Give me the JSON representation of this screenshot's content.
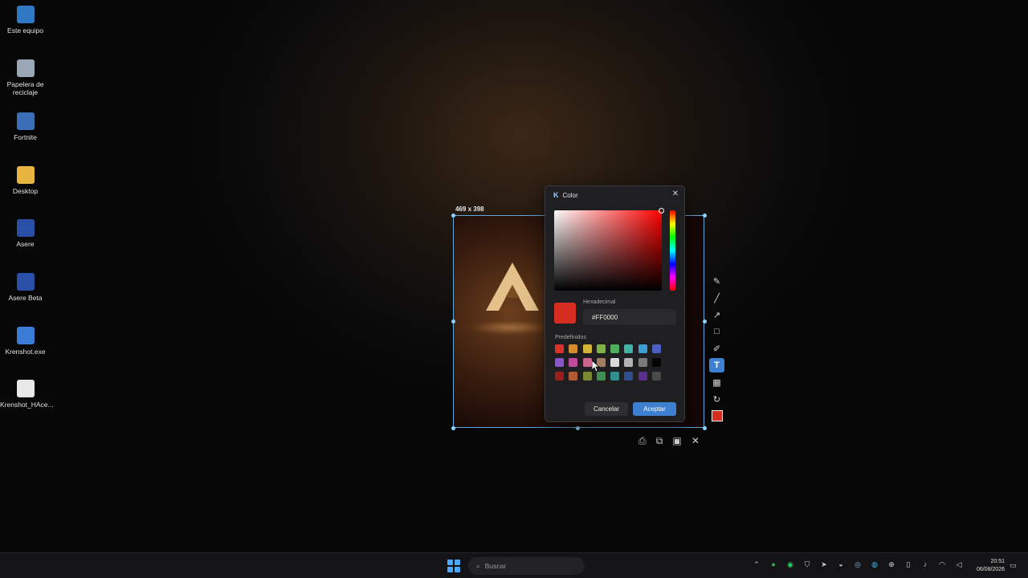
{
  "desktop": {
    "icons": [
      {
        "label": "Este equipo",
        "icon": "computer-icon",
        "color": "#2f78c6"
      },
      {
        "label": "Papelera de reciclaje",
        "icon": "recycle-bin-icon",
        "color": "#9aa7b5"
      },
      {
        "label": "Fortnite",
        "icon": "fortnite-icon",
        "color": "#3a6fb8"
      },
      {
        "label": "Desktop",
        "icon": "folder-icon",
        "color": "#e6b43f"
      },
      {
        "label": "Asere",
        "icon": "asere-icon",
        "color": "#2a4fa8"
      },
      {
        "label": "Asere Beta",
        "icon": "asere-beta-icon",
        "color": "#2a4fa8"
      },
      {
        "label": "Krenshot.exe",
        "icon": "krenshot-icon",
        "color": "#3a7bd5"
      },
      {
        "label": "Krenshot_HAce...",
        "icon": "file-icon",
        "color": "#e8e8e8"
      }
    ]
  },
  "capture": {
    "size_label": "469 x 398"
  },
  "toolbar": {
    "tools": [
      {
        "name": "pen-tool",
        "glyph": "✎"
      },
      {
        "name": "line-tool",
        "glyph": "╱"
      },
      {
        "name": "arrow-tool",
        "glyph": "↗"
      },
      {
        "name": "rectangle-tool",
        "glyph": "□"
      },
      {
        "name": "marker-tool",
        "glyph": "✐"
      },
      {
        "name": "text-tool",
        "glyph": "T"
      },
      {
        "name": "blur-tool",
        "glyph": "▦"
      },
      {
        "name": "undo-tool",
        "glyph": "↻"
      }
    ],
    "active_tool": "text-tool",
    "current_color": "#d52d20",
    "actions": [
      {
        "name": "print-button",
        "glyph": "⎙"
      },
      {
        "name": "copy-button",
        "glyph": "⧉"
      },
      {
        "name": "save-button",
        "glyph": "▣"
      },
      {
        "name": "close-capture-button",
        "glyph": "✕"
      }
    ]
  },
  "dialog": {
    "title": "Color",
    "close_glyph": "✕",
    "hex_label": "Hexadecimal",
    "hex_value": "#FF0000",
    "preset_label": "Predefinidos",
    "presets": [
      "#d8322b",
      "#d98c2b",
      "#d6b236",
      "#7fb345",
      "#4fae5e",
      "#3fb3a6",
      "#3c9fd4",
      "#4c5fc2",
      "#8a55c9",
      "#c24a9c",
      "#c9658f",
      "#a47c62",
      "#d9d9d9",
      "#b3b3b3",
      "#7a7a7a",
      "#050505",
      "#9a1e1e",
      "#b25a32",
      "#7a8a32",
      "#3f8f4f",
      "#2f8f8f",
      "#2f4f8f",
      "#5a2f8f",
      "#4a4a4a"
    ],
    "cancel_label": "Cancelar",
    "accept_label": "Aceptar"
  },
  "taskbar": {
    "search_placeholder": "Buscar",
    "tray_icons": [
      "chevron-up-icon",
      "spotify-icon",
      "whatsapp-icon",
      "shield-icon",
      "telegram-icon",
      "discord-icon",
      "steam-icon",
      "edge-icon",
      "gamepad-icon",
      "battery-icon",
      "mic-icon",
      "wifi-icon",
      "volume-icon"
    ],
    "time": "20:51",
    "date": "06/08/2026"
  }
}
